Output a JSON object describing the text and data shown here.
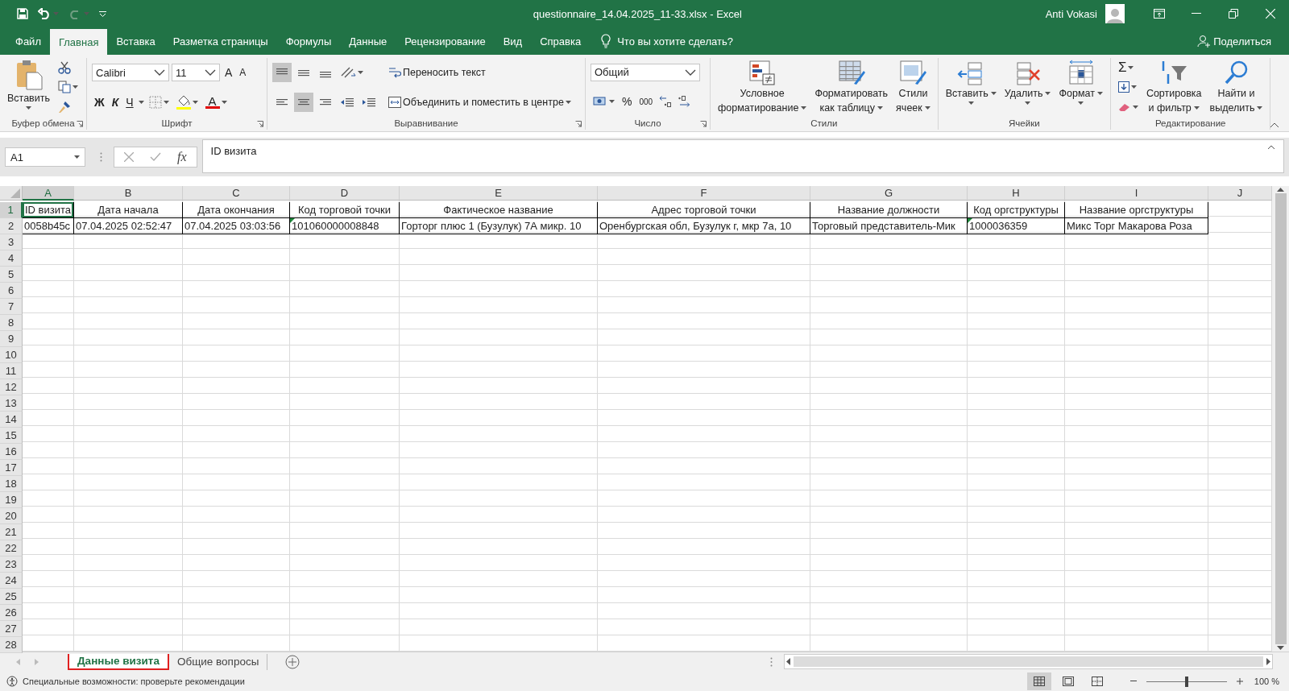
{
  "title_bar": {
    "title": "questionnaire_14.04.2025_11-33.xlsx  -  Excel",
    "user": "Anti Vokasi"
  },
  "menu_tabs": [
    {
      "label": "Файл",
      "selected": false
    },
    {
      "label": "Главная",
      "selected": true
    },
    {
      "label": "Вставка",
      "selected": false
    },
    {
      "label": "Разметка страницы",
      "selected": false
    },
    {
      "label": "Формулы",
      "selected": false
    },
    {
      "label": "Данные",
      "selected": false
    },
    {
      "label": "Рецензирование",
      "selected": false
    },
    {
      "label": "Вид",
      "selected": false
    },
    {
      "label": "Справка",
      "selected": false
    }
  ],
  "tell_me": "Что вы хотите сделать?",
  "share": "Поделиться",
  "ribbon": {
    "clipboard": {
      "label": "Буфер обмена",
      "paste": "Вставить"
    },
    "font": {
      "label": "Шрифт",
      "font_name": "Calibri",
      "font_size": "11",
      "grow": "A",
      "shrink": "A",
      "bold": "Ж",
      "italic": "К",
      "underline": "Ч",
      "font_color": "A"
    },
    "alignment": {
      "label": "Выравнивание",
      "wrap": "Переносить текст",
      "merge": "Объединить и поместить в центре"
    },
    "number": {
      "label": "Число",
      "format": "Общий",
      "percent": "%",
      "thousands": "000"
    },
    "styles": {
      "label": "Стили",
      "buttons": [
        {
          "kind": "conditional",
          "lines": [
            "Условное",
            "форматирование"
          ]
        },
        {
          "kind": "table",
          "lines": [
            "Форматировать",
            "как таблицу"
          ]
        },
        {
          "kind": "cellstyles",
          "lines": [
            "Стили",
            "ячеек"
          ]
        }
      ]
    },
    "cells": {
      "label": "Ячейки",
      "buttons": [
        {
          "kind": "insert",
          "lines": [
            "Вставить"
          ]
        },
        {
          "kind": "delete",
          "lines": [
            "Удалить"
          ]
        },
        {
          "kind": "format",
          "lines": [
            "Формат"
          ]
        }
      ]
    },
    "editing": {
      "label": "Редактирование",
      "autosum": "Σ",
      "sort": [
        "Сортировка",
        "и фильтр"
      ],
      "find": [
        "Найти и",
        "выделить"
      ]
    }
  },
  "formula_bar": {
    "name_box": "A1",
    "fx": "fx",
    "formula": "ID визита"
  },
  "columns": [
    {
      "letter": "A",
      "selected": true
    },
    {
      "letter": "B",
      "selected": false
    },
    {
      "letter": "C",
      "selected": false
    },
    {
      "letter": "D",
      "selected": false
    },
    {
      "letter": "E",
      "selected": false
    },
    {
      "letter": "F",
      "selected": false
    },
    {
      "letter": "G",
      "selected": false
    },
    {
      "letter": "H",
      "selected": false
    },
    {
      "letter": "I",
      "selected": false
    },
    {
      "letter": "J",
      "selected": false
    }
  ],
  "rows": [
    {
      "number": "1",
      "selected": true,
      "cells": [
        {
          "text": "ID визита",
          "selected": true,
          "warning": false
        },
        {
          "text": "Дата начала",
          "selected": false,
          "warning": false
        },
        {
          "text": "Дата окончания",
          "selected": false,
          "warning": false
        },
        {
          "text": "Код торговой точки",
          "selected": false,
          "warning": false
        },
        {
          "text": "Фактическое название",
          "selected": false,
          "warning": false
        },
        {
          "text": "Адрес торговой точки",
          "selected": false,
          "warning": false
        },
        {
          "text": "Название должности",
          "selected": false,
          "warning": false
        },
        {
          "text": "Код оргструктуры",
          "selected": false,
          "warning": false
        },
        {
          "text": "Название оргструктуры",
          "selected": false,
          "warning": false
        }
      ]
    },
    {
      "number": "2",
      "selected": false,
      "cells": [
        {
          "text": "0058b45c",
          "selected": false,
          "warning": false
        },
        {
          "text": "07.04.2025 02:52:47",
          "selected": false,
          "warning": false
        },
        {
          "text": "07.04.2025 03:03:56",
          "selected": false,
          "warning": false
        },
        {
          "text": "101060000008848",
          "selected": false,
          "warning": true
        },
        {
          "text": "Горторг плюс 1 (Бузулук) 7А микр. 10",
          "selected": false,
          "warning": false
        },
        {
          "text": "Оренбургская обл, Бузулук г, мкр 7а, 10",
          "selected": false,
          "warning": false
        },
        {
          "text": "Торговый представитель-Мик",
          "selected": false,
          "warning": false
        },
        {
          "text": "1000036359",
          "selected": false,
          "warning": true
        },
        {
          "text": "Микс Торг Макарова Роза",
          "selected": false,
          "warning": false
        }
      ]
    },
    {
      "number": "3",
      "selected": false
    },
    {
      "number": "4",
      "selected": false
    },
    {
      "number": "5",
      "selected": false
    },
    {
      "number": "6",
      "selected": false
    },
    {
      "number": "7",
      "selected": false
    },
    {
      "number": "8",
      "selected": false
    },
    {
      "number": "9",
      "selected": false
    },
    {
      "number": "10",
      "selected": false
    },
    {
      "number": "11",
      "selected": false
    },
    {
      "number": "12",
      "selected": false
    },
    {
      "number": "13",
      "selected": false
    },
    {
      "number": "14",
      "selected": false
    },
    {
      "number": "15",
      "selected": false
    },
    {
      "number": "16",
      "selected": false
    },
    {
      "number": "17",
      "selected": false
    },
    {
      "number": "18",
      "selected": false
    },
    {
      "number": "19",
      "selected": false
    },
    {
      "number": "20",
      "selected": false
    },
    {
      "number": "21",
      "selected": false
    },
    {
      "number": "22",
      "selected": false
    },
    {
      "number": "23",
      "selected": false
    },
    {
      "number": "24",
      "selected": false
    },
    {
      "number": "25",
      "selected": false
    },
    {
      "number": "26",
      "selected": false
    },
    {
      "number": "27",
      "selected": false
    },
    {
      "number": "28",
      "selected": false
    }
  ],
  "sheet_tabs": [
    {
      "label": "Данные визита",
      "selected": true
    },
    {
      "label": "Общие вопросы",
      "selected": false
    }
  ],
  "status_bar": {
    "text": "Специальные возможности: проверьте рекомендации",
    "zoom_slider": {
      "level": 0.5
    },
    "zoom": "100 %"
  }
}
